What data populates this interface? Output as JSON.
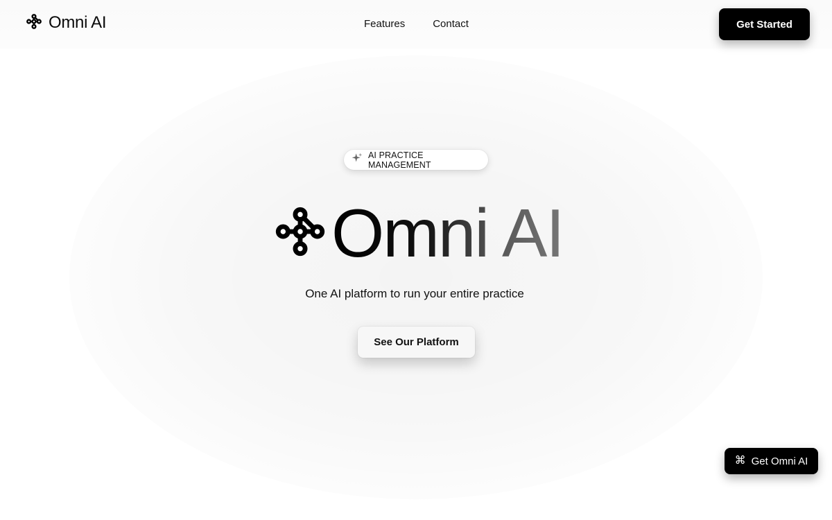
{
  "header": {
    "brand_name": "Omni AI",
    "nav": [
      {
        "label": "Features"
      },
      {
        "label": "Contact"
      }
    ],
    "cta_label": "Get Started"
  },
  "hero": {
    "badge_icon": "sparkle-icon",
    "badge_label": "AI PRACTICE MANAGEMENT",
    "title": "Omni AI",
    "title_icon": "omni-logo-icon",
    "subtitle": "One AI platform to run your entire practice",
    "cta_label": "See Our Platform"
  },
  "floating": {
    "icon": "command-icon",
    "glyph": "⌘",
    "label": "Get Omni AI"
  },
  "colors": {
    "primary": "#000000",
    "background": "#ffffff",
    "text": "#0a0a0a"
  }
}
